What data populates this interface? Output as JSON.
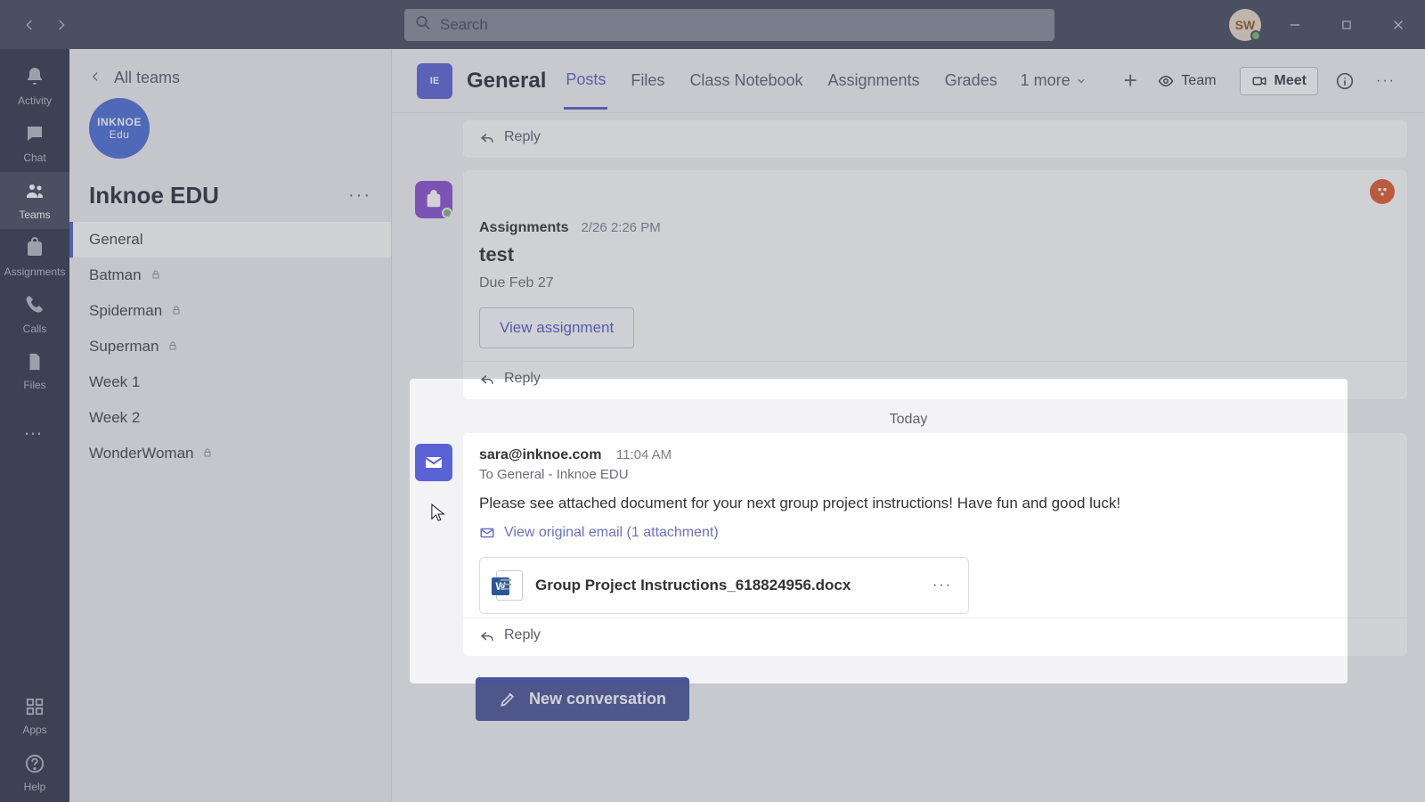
{
  "titlebar": {
    "search_placeholder": "Search",
    "user_initials": "SW"
  },
  "left_rail": {
    "items": [
      {
        "icon": "bell",
        "label": "Activity"
      },
      {
        "icon": "chat",
        "label": "Chat"
      },
      {
        "icon": "teams",
        "label": "Teams"
      },
      {
        "icon": "assign",
        "label": "Assignments"
      },
      {
        "icon": "phone",
        "label": "Calls"
      },
      {
        "icon": "file",
        "label": "Files"
      }
    ],
    "more_icon": "…",
    "apps_label": "Apps",
    "help_label": "Help"
  },
  "team_sidebar": {
    "back_label": "All teams",
    "logo_line1": "INKNOE",
    "logo_line2": "Edu",
    "team_name": "Inknoe EDU",
    "channels": [
      {
        "name": "General",
        "private": false,
        "selected": true
      },
      {
        "name": "Batman",
        "private": true
      },
      {
        "name": "Spiderman",
        "private": true
      },
      {
        "name": "Superman",
        "private": true
      },
      {
        "name": "Week 1",
        "private": false
      },
      {
        "name": "Week 2",
        "private": false
      },
      {
        "name": "WonderWoman",
        "private": true
      }
    ]
  },
  "channel_header": {
    "title": "General",
    "tabs": [
      {
        "label": "Posts",
        "active": true
      },
      {
        "label": "Files"
      },
      {
        "label": "Class Notebook"
      },
      {
        "label": "Assignments"
      },
      {
        "label": "Grades"
      }
    ],
    "more_label": "1 more",
    "team_btn": "Team",
    "meet_btn": "Meet"
  },
  "messages": {
    "reply_label": "Reply",
    "assignment": {
      "sender": "Assignments",
      "time": "2/26 2:26 PM",
      "title": "test",
      "due": "Due Feb 27",
      "view_btn": "View assignment"
    },
    "today_label": "Today",
    "email": {
      "from": "sara@inknoe.com",
      "time": "11:04 AM",
      "to": "To General - Inknoe EDU",
      "body": "Please see attached document for your next group project instructions! Have fun and good luck!",
      "view_original": "View original email (1 attachment)",
      "attachment_name": "Group Project Instructions_618824956.docx"
    }
  },
  "compose": {
    "new_conv": "New conversation"
  }
}
